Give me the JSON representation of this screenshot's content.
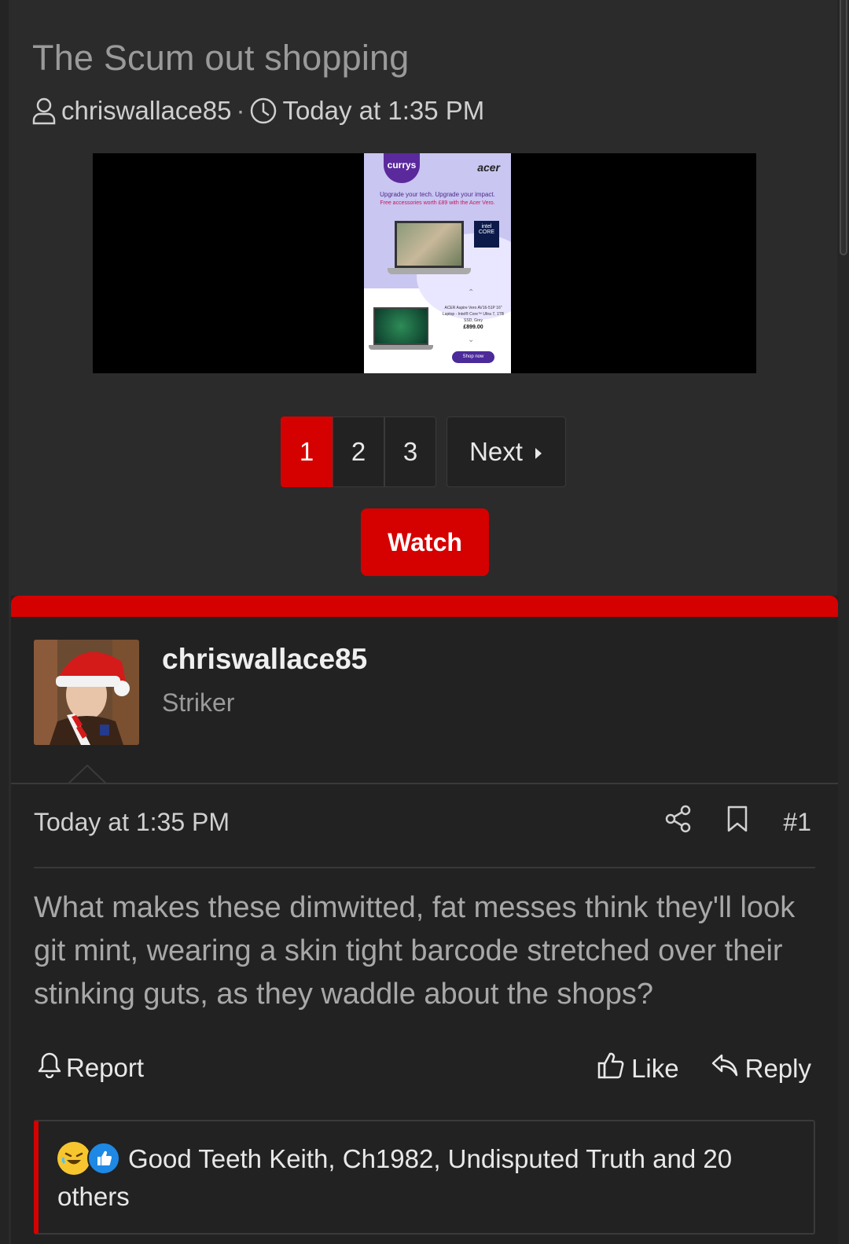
{
  "thread": {
    "title": "The Scum out shopping",
    "author": "chriswallace85",
    "separator": "·",
    "date": "Today at 1:35 PM"
  },
  "ad": {
    "brand": "currys",
    "partner": "acer",
    "line1": "Upgrade your tech. Upgrade your impact.",
    "line2": "Free accessories worth £89 with the Acer Vero.",
    "intel_label": "intel CORE",
    "product": "ACER Aspire Vero AV16-51P 16\" Laptop - Intel® Core™ Ultra 7, 1TB SSD, Grey",
    "price": "£899.00",
    "cta": "Shop now"
  },
  "pagination": {
    "pages": [
      "1",
      "2",
      "3"
    ],
    "current": "1",
    "next_label": "Next"
  },
  "watch_label": "Watch",
  "post": {
    "username": "chriswallace85",
    "user_title": "Striker",
    "time": "Today at 1:35 PM",
    "post_number": "#1",
    "body": "What makes these dimwitted, fat messes think they'll look git mint, wearing a skin tight barcode stretched over their stinking guts, as they waddle about the shops?",
    "report_label": "Report",
    "like_label": "Like",
    "reply_label": "Reply",
    "reactions_text": "Good Teeth Keith, Ch1982, Undisputed Truth and 20 others"
  },
  "colors": {
    "accent": "#d50000",
    "background": "#2b2b2b",
    "post_background": "#222222"
  },
  "icons": [
    "user-icon",
    "clock-icon",
    "caret-right-icon",
    "share-icon",
    "bookmark-icon",
    "bell-icon",
    "thumbs-up-icon",
    "reply-icon",
    "laugh-reaction-icon",
    "like-reaction-icon"
  ]
}
